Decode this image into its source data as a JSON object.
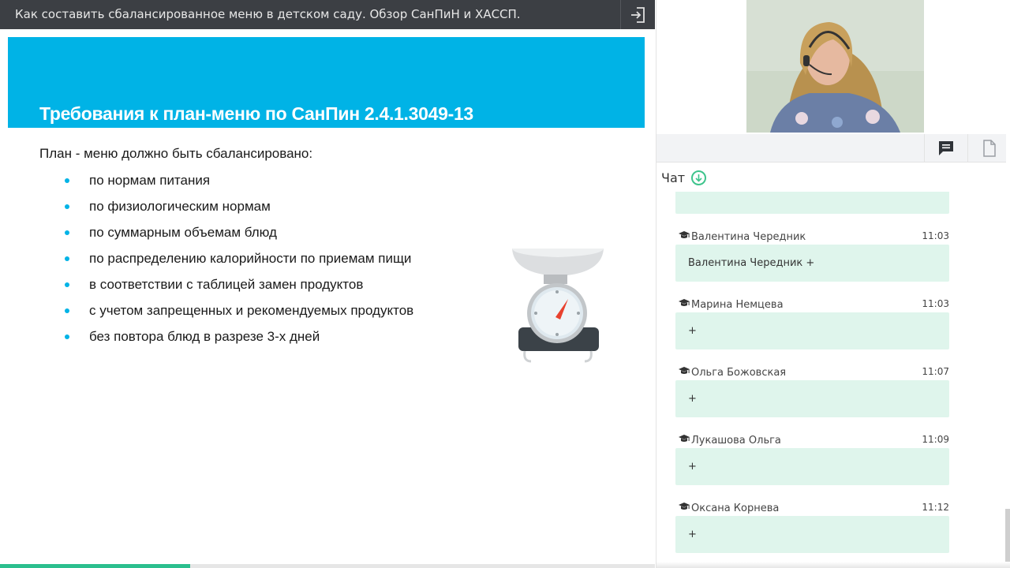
{
  "header": {
    "title": "Как составить сбалансированное меню в детском саду. Обзор СанПиН и ХАССП.",
    "exit_icon": "exit-icon"
  },
  "slide": {
    "heading": "Требования к план-меню по СанПин 2.4.1.3049-13",
    "intro": "План - меню должно быть сбалансировано:",
    "items": [
      "по нормам питания",
      "по физиологическим нормам",
      "по суммарным объемам блюд",
      "по распределению калорийности по приемам пищи",
      "в соответствии с  таблицей замен продуктов",
      "с учетом запрещенных и рекомендуемых продуктов",
      "без повтора блюд в разрезе 3-х дней"
    ],
    "accent_color": "#00b3e6",
    "illustration_icon": "kitchen-scale-icon"
  },
  "progress": {
    "fraction": 0.29,
    "color": "#2bbf8e"
  },
  "toolbar": {
    "chat_icon": "chat-icon",
    "files_icon": "file-icon"
  },
  "chat": {
    "title": "Чат",
    "messages": [
      {
        "author": "",
        "time": "",
        "text": "+"
      },
      {
        "author": "Валентина Чередник",
        "time": "11:03",
        "text": "Валентина Чередник +"
      },
      {
        "author": "Марина Немцева",
        "time": "11:03",
        "text": "+"
      },
      {
        "author": "Ольга Божовская",
        "time": "11:07",
        "text": "+"
      },
      {
        "author": "Лукашова Ольга",
        "time": "11:09",
        "text": "+"
      },
      {
        "author": "Оксана Корнева",
        "time": "11:12",
        "text": "+"
      }
    ],
    "bubble_color": "#dff5ec"
  }
}
